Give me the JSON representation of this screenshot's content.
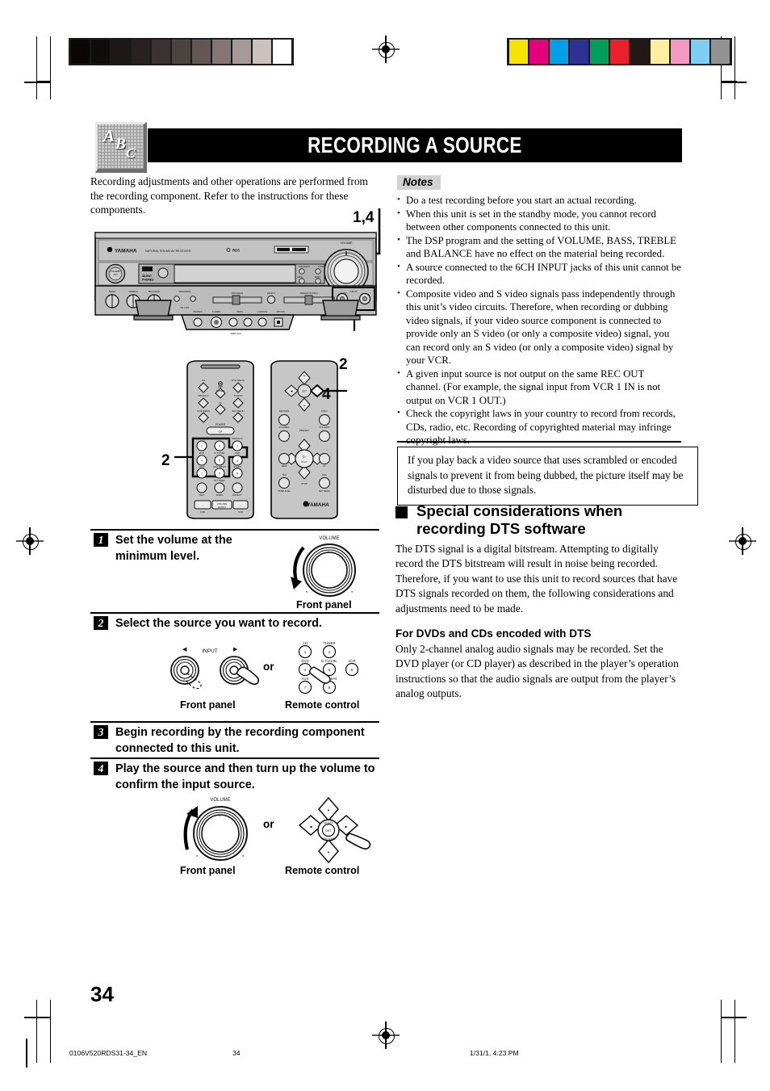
{
  "header": {
    "title": "RECORDING A SOURCE",
    "icon_letters": [
      "A",
      "B",
      "C"
    ]
  },
  "intro": {
    "text": "Recording adjustments and other operations are performed from the recording component. Refer to the instructions for these components."
  },
  "notes": {
    "label": "Notes",
    "items": [
      "Do a test recording before you start an actual recording.",
      "When this unit is set in the standby mode, you cannot record between other components connected to this unit.",
      "The DSP program and the setting of VOLUME, BASS, TREBLE and BALANCE have no effect on the material being recorded.",
      "A source connected to the 6CH INPUT jacks of this unit cannot be recorded.",
      "Composite video and S video signals pass independently through this unit’s video circuits. Therefore, when recording or dubbing video signals, if your video source component is connected to provide only an S video (or only a composite video) signal, you can record only an S video (or only a composite video) signal by your VCR.",
      "A given input source is not output on the same REC OUT channel. (For example, the signal input from VCR 1 IN is not output on VCR 1 OUT.)",
      "Check the copyright laws in your country to record from records, CDs, radio, etc. Recording of copyrighted material may infringe copyright laws."
    ]
  },
  "scramble_box": {
    "text": "If you play back a video source that uses scrambled or encoded signals to prevent it from being dubbed, the picture itself may be disturbed due to those signals."
  },
  "dts_section": {
    "heading": "Special considerations when recording DTS software",
    "paragraph": "The DTS signal is a digital bitstream. Attempting to digitally record the DTS bitstream will result in noise being recorded. Therefore, if you want to use this unit to record sources that have DTS signals recorded on them, the following considerations and adjustments need to be made.",
    "subheading": "For DVDs and CDs encoded with DTS",
    "subparagraph": "Only 2-channel analog audio signals may be recorded. Set the DVD player (or CD player) as described in the player’s operation instructions so that the audio signals are output from the player’s analog outputs."
  },
  "steps": [
    {
      "num": "1",
      "text": "Set the volume at the minimum level."
    },
    {
      "num": "2",
      "text": "Select the source you want to record."
    },
    {
      "num": "3",
      "text": "Begin recording by the recording component connected to this unit."
    },
    {
      "num": "4",
      "text": "Play the source and then turn up the volume to confirm the input source."
    }
  ],
  "callouts": {
    "top": "1,4",
    "front_input": "2",
    "remote_source": "2",
    "remote_volume": "4"
  },
  "captions": {
    "front_panel": "Front panel",
    "remote_control": "Remote control",
    "or": "or",
    "volume_label": "VOLUME",
    "input_label": "INPUT"
  },
  "receiver": {
    "brand": "YAMAHA",
    "tagline": "NATURAL SOUND  AV RECEIVER",
    "model_tag": "RDS",
    "volume_label": "VOLUME",
    "knob_labels": [
      "BASS",
      "TREBLE",
      "BALANCE"
    ],
    "input_label": "INPUT"
  },
  "remote_buttons": [
    {
      "label": "CD",
      "num": "1"
    },
    {
      "label": "TUNER",
      "num": "2"
    },
    {
      "label": "DVD",
      "num": "4"
    },
    {
      "label": "D.TV/CBL",
      "num": "5"
    },
    {
      "label": "VCR",
      "num": "6"
    },
    {
      "label": "AUX",
      "num": "7"
    },
    {
      "label": "MD/CD-R",
      "num": "8"
    }
  ],
  "footer": {
    "page_number": "34",
    "file_name": "0106V520RDS31-34_EN",
    "sheet_number": "34",
    "timestamp": "1/31/1, 4:23 PM"
  },
  "colors": {
    "title_bar_bg": "#000000",
    "notes_label_bg": "#d2d2d2",
    "gray_bar": [
      "#0a0606",
      "#120d0d",
      "#1d1716",
      "#282120",
      "#3b3130",
      "#4e4241",
      "#635654",
      "#837674",
      "#a59a97",
      "#cbc2be",
      "#ffffff"
    ],
    "color_bar": [
      "#f5e400",
      "#e5007e",
      "#00a0e9",
      "#2e3192",
      "#00a05a",
      "#e8212a",
      "#231815",
      "#fcf0a0",
      "#f49ac1",
      "#7ecef4",
      "#929292"
    ]
  }
}
